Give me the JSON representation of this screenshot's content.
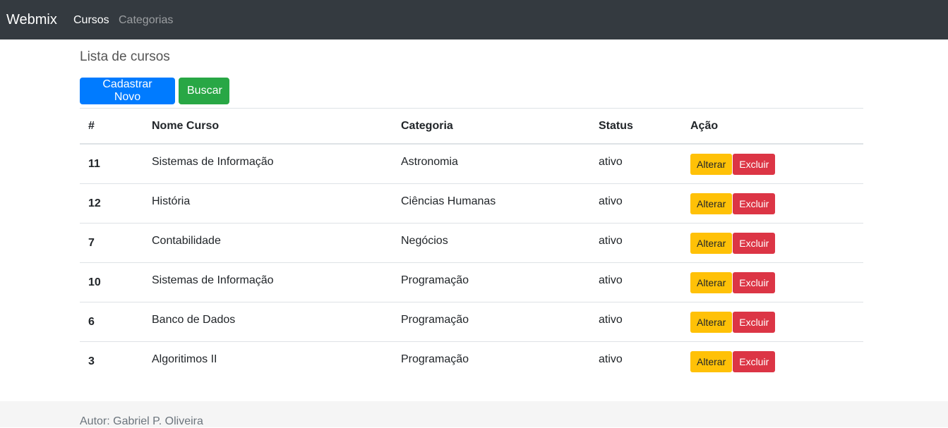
{
  "navbar": {
    "brand": "Webmix",
    "links": [
      {
        "label": "Cursos"
      },
      {
        "label": "Categorias"
      }
    ]
  },
  "page": {
    "title": "Lista de cursos",
    "buttons": {
      "new": "Cadastrar Novo",
      "search": "Buscar"
    }
  },
  "table": {
    "headers": [
      "#",
      "Nome Curso",
      "Categoria",
      "Status",
      "Ação"
    ],
    "rows": [
      {
        "id": "11",
        "name": "Sistemas de Informação",
        "category": "Astronomia",
        "status": "ativo"
      },
      {
        "id": "12",
        "name": "História",
        "category": "Ciências Humanas",
        "status": "ativo"
      },
      {
        "id": "7",
        "name": "Contabilidade",
        "category": "Negócios",
        "status": "ativo"
      },
      {
        "id": "10",
        "name": "Sistemas de Informação",
        "category": "Programação",
        "status": "ativo"
      },
      {
        "id": "6",
        "name": "Banco de Dados",
        "category": "Programação",
        "status": "ativo"
      },
      {
        "id": "3",
        "name": "Algoritimos II",
        "category": "Programação",
        "status": "ativo"
      }
    ],
    "actions": {
      "edit": "Alterar",
      "delete": "Excluir"
    }
  },
  "footer": {
    "text": "Autor: Gabriel P. Oliveira"
  },
  "colors": {
    "navbar": "#343a40",
    "primary": "#007bff",
    "success": "#28a745",
    "warning": "#ffc107",
    "danger": "#dc3545"
  }
}
